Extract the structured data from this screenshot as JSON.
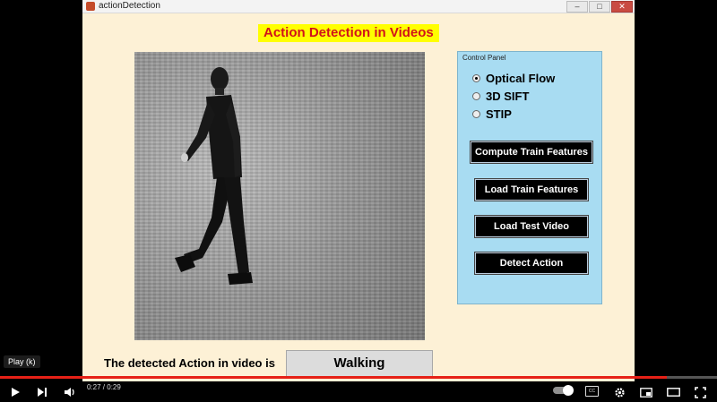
{
  "window": {
    "title": "actionDetection",
    "minimize": "–",
    "maximize": "□",
    "close": "✕"
  },
  "heading": "Action Detection in Videos",
  "control_panel": {
    "caption": "Control Panel",
    "options": [
      "Optical Flow",
      "3D SIFT",
      "STIP"
    ],
    "selected": "Optical Flow",
    "buttons": {
      "compute": "Compute Train Features",
      "load_train": "Load Train Features",
      "load_video": "Load Test Video",
      "detect": "Detect Action"
    }
  },
  "result": {
    "label": "The detected Action in video is",
    "value": "Walking"
  },
  "player": {
    "tooltip": "Play (k)",
    "time": "0:27 / 0:29",
    "progress": 0.93,
    "colors": {
      "progress": "#e62117",
      "heading_bg": "#ffff00",
      "heading_text": "#d1121b",
      "panel_bg": "#a8dcf2",
      "window_bg": "#fdf1d6"
    }
  }
}
